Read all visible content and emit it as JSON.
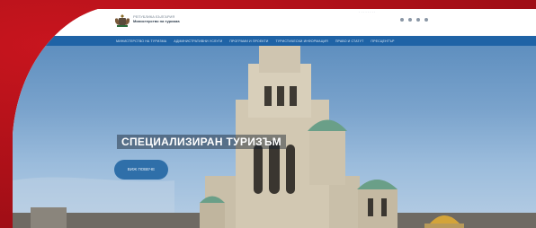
{
  "header": {
    "ministry_line1": "РЕПУБЛИКА БЪЛГАРИЯ",
    "ministry_line2": "Министерство на туризма",
    "top_links": "· · · · · · · ·"
  },
  "nav": {
    "items": [
      "МИНИСТЕРСТВО НА ТУРИЗМА",
      "АДМИНИСТРАТИВНИ УСЛУГИ",
      "ПРОГРАМИ И ПРОЕКТИ",
      "ТУРИСТИЧЕСКИ ИНФОРМАЦИЯ",
      "ПРАВО И СТАТУТ",
      "ПРЕСЦЕНТЪР"
    ]
  },
  "hero": {
    "title": "СПЕЦИАЛИЗИРАН ТУРИЗЪМ",
    "button_label": "ВИЖ ПОВЕЧЕ"
  },
  "colors": {
    "frame": "#b3121a",
    "nav": "#1f63a6",
    "button": "#2f6fa9"
  }
}
